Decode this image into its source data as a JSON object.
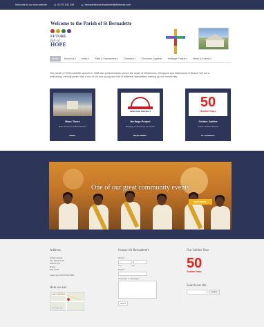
{
  "topbar": {
    "welcome": "Welcome to our new website",
    "phone": "01373 832 048",
    "email": "bernadettechurchwebsite@btinternet.com"
  },
  "header": {
    "title": "Welcome to the Parish of St Bernadette",
    "logo_line1": "FUTURE",
    "logo_line2": "full of",
    "logo_line3": "HOPE"
  },
  "nav": {
    "items": [
      {
        "label": "Home",
        "active": true,
        "has_menu": false
      },
      {
        "label": "About Us",
        "active": false,
        "has_menu": true
      },
      {
        "label": "Mass",
        "active": false,
        "has_menu": true
      },
      {
        "label": "Faith & Sacraments",
        "active": false,
        "has_menu": true
      },
      {
        "label": "Outreach",
        "active": false,
        "has_menu": true
      },
      {
        "label": "Churches Together",
        "active": false,
        "has_menu": false
      },
      {
        "label": "Heritage Project",
        "active": false,
        "has_menu": true
      },
      {
        "label": "News & Events",
        "active": false,
        "has_menu": true
      }
    ],
    "chevron_icon": "chevron-down-icon"
  },
  "intro": {
    "text": "The parish of St Bernadette opened in 1988 and predominantly serves the areas of Whitchurch, Hengrove and Stockwood in Bristol. We are a welcoming, friendly parish with a mix of old and young and lots of different nationalities making up our community."
  },
  "cards": [
    {
      "title": "Mass Times",
      "desc": "Mass Times at St Bernadette's",
      "button": "VIEW  ›"
    },
    {
      "title": "Heritage Project",
      "desc": "Bringing a New Hope for Parish",
      "button": "READ MORE  ›",
      "logo_text": "HERITAGE PROJECT"
    },
    {
      "title": "Golden Jubilee",
      "desc": "Golden Jubilee Events",
      "button": "ALL EVENTS  ›",
      "number": "50",
      "sub": "Golden Years"
    }
  ],
  "banner": {
    "caption": "One of our great community events",
    "button": "READ MORE  ›"
  },
  "footer": {
    "address": {
      "heading": "Address",
      "lines": [
        "St Bernadette",
        "792 Wells Road",
        "Whitchurch",
        "Bristol",
        "BS14 9HT"
      ],
      "telephone": "Telephone 01275 832 888"
    },
    "map": {
      "heading": "Here we are!",
      "label": "Map & Directions",
      "view_larger": "View larger map"
    },
    "contact": {
      "heading": "Contact St Bernadette's",
      "name_label": "Name *",
      "first_label": "First",
      "last_label": "Last",
      "email_label": "Email *",
      "comment_label": "Comment or Message *",
      "submit": "Submit"
    },
    "jubilee": {
      "heading": "Our Jubilee Year",
      "number": "50",
      "sub": "Golden Years"
    },
    "search": {
      "heading": "Search our site",
      "button": "Search"
    }
  },
  "colors": {
    "navy": "#2d3558",
    "accent_red": "#e0231b",
    "button_gold": "#f0b225"
  }
}
